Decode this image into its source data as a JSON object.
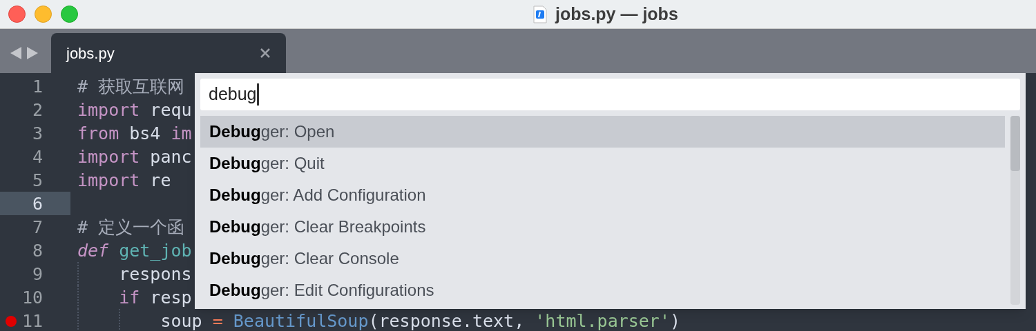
{
  "window": {
    "title": "jobs.py — jobs"
  },
  "tabs": [
    {
      "label": "jobs.py",
      "selected": true
    }
  ],
  "editor": {
    "lines": [
      {
        "number": "1",
        "current": false,
        "breakpoint": false,
        "tokens": [
          {
            "kind": "comment",
            "text": "# 获取互联网"
          }
        ]
      },
      {
        "number": "2",
        "current": false,
        "breakpoint": false,
        "tokens": [
          {
            "kind": "keyword",
            "text": "import"
          },
          {
            "kind": "plain",
            "text": " requ"
          }
        ]
      },
      {
        "number": "3",
        "current": false,
        "breakpoint": false,
        "tokens": [
          {
            "kind": "keyword",
            "text": "from"
          },
          {
            "kind": "plain",
            "text": " bs4 "
          },
          {
            "kind": "keyword",
            "text": "im"
          }
        ]
      },
      {
        "number": "4",
        "current": false,
        "breakpoint": false,
        "tokens": [
          {
            "kind": "keyword",
            "text": "import"
          },
          {
            "kind": "plain",
            "text": " panc"
          }
        ]
      },
      {
        "number": "5",
        "current": false,
        "breakpoint": false,
        "tokens": [
          {
            "kind": "keyword",
            "text": "import"
          },
          {
            "kind": "plain",
            "text": " re"
          }
        ]
      },
      {
        "number": "6",
        "current": true,
        "breakpoint": false
      },
      {
        "number": "7",
        "current": false,
        "breakpoint": false,
        "tokens": [
          {
            "kind": "comment",
            "text": "# 定义一个函"
          }
        ]
      },
      {
        "number": "8",
        "current": false,
        "breakpoint": false,
        "tokens": [
          {
            "kind": "storage",
            "text": "def"
          },
          {
            "kind": "function",
            "text": " get_job"
          }
        ]
      },
      {
        "number": "9",
        "current": false,
        "breakpoint": false,
        "tokens": [
          {
            "kind": "plain",
            "text": "    respons"
          }
        ]
      },
      {
        "number": "10",
        "current": false,
        "breakpoint": false,
        "tokens": [
          {
            "kind": "keyword",
            "text": "    if"
          },
          {
            "kind": "plain",
            "text": " resp"
          }
        ]
      },
      {
        "number": "11",
        "current": false,
        "breakpoint": true,
        "tokens": [
          {
            "kind": "plain",
            "text": "        soup "
          },
          {
            "kind": "operator",
            "text": "="
          },
          {
            "kind": "class",
            "text": " BeautifulSoup"
          },
          {
            "kind": "plain",
            "text": "(response.text, "
          },
          {
            "kind": "string",
            "text": "'html.parser'"
          },
          {
            "kind": "plain",
            "text": ")"
          }
        ]
      }
    ]
  },
  "command_palette": {
    "query": "debug",
    "items": [
      {
        "label": "**Debug**ger: Open",
        "selected": true
      },
      {
        "label": "**Debug**ger: Quit",
        "selected": false
      },
      {
        "label": "**Debug**ger: Add Configuration",
        "selected": false
      },
      {
        "label": "**Debug**ger: Clear Breakpoints",
        "selected": false
      },
      {
        "label": "**Debug**ger: Clear Console",
        "selected": false
      },
      {
        "label": "**Debug**ger: Edit Configurations",
        "selected": false
      }
    ]
  }
}
